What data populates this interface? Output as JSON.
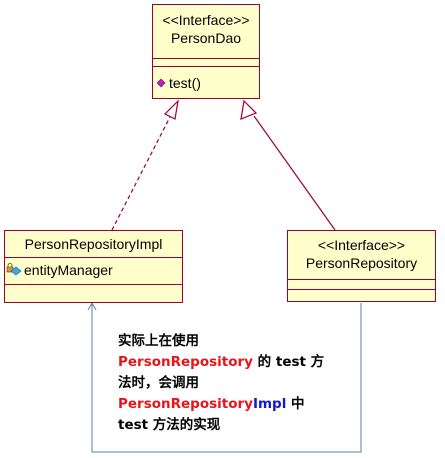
{
  "person_dao": {
    "stereotype": "<<Interface>>",
    "name": "PersonDao",
    "method": "test()",
    "method_icon": "purple-diamond-icon"
  },
  "impl": {
    "name": "PersonRepositoryImpl",
    "field": "entityManager",
    "field_icon": "protected-field-icon"
  },
  "repository": {
    "stereotype": "<<Interface>>",
    "name": "PersonRepository"
  },
  "note": {
    "line1": "实际上在使用",
    "line2_red": "PersonRepository",
    "line2_rest": " 的 test 方",
    "line3": "法时，会调用",
    "line4_red": "PersonRepository",
    "line4_blue": "Impl",
    "line4_rest": " 中",
    "line5": "test 方法的实现"
  },
  "colors": {
    "box_fill": "#ffffcc",
    "box_border": "#990033",
    "connector": "#990033",
    "annotation_arrow": "#5b7fa6",
    "note_red": "#e8141c",
    "note_blue": "#1515d6"
  }
}
